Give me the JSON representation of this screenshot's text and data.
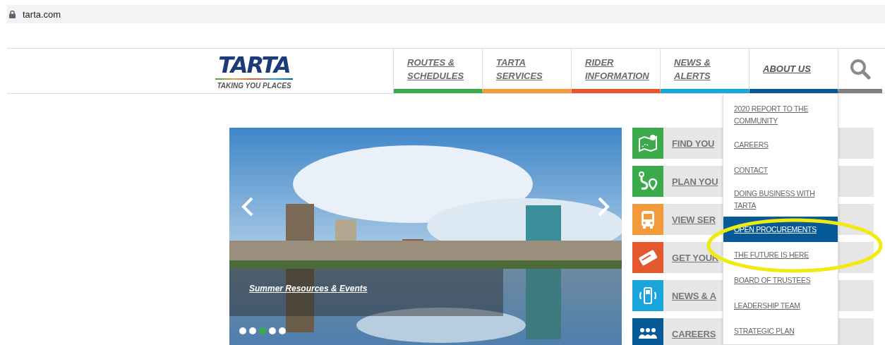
{
  "browser": {
    "url": "tarta.com"
  },
  "header": {
    "logo": {
      "name": "TARTA",
      "tagline": "TAKING YOU PLACES"
    },
    "nav": [
      {
        "label": "ROUTES & SCHEDULES",
        "color": "#3aaa4a",
        "expanded": false
      },
      {
        "label": "TARTA SERVICES",
        "color": "#f39a3b",
        "expanded": false
      },
      {
        "label": "RIDER INFORMATION",
        "color": "#e4582d",
        "expanded": false
      },
      {
        "label": "NEWS & ALERTS",
        "color": "#1aa6dc",
        "expanded": false
      },
      {
        "label": "ABOUT US",
        "color": "#075a98",
        "expanded": true
      }
    ]
  },
  "dropdown": [
    {
      "label": "2020 REPORT TO THE COMMUNITY",
      "selected": false
    },
    {
      "label": "CAREERS",
      "selected": false
    },
    {
      "label": "CONTACT",
      "selected": false
    },
    {
      "label": "DOING BUSINESS WITH TARTA",
      "selected": false
    },
    {
      "label": "OPEN PROCUREMENTS",
      "selected": true
    },
    {
      "label": "THE FUTURE IS HERE",
      "selected": false
    },
    {
      "label": "BOARD OF TRUSTEES",
      "selected": false
    },
    {
      "label": "LEADERSHIP TEAM",
      "selected": false
    },
    {
      "label": "STRATEGIC PLAN",
      "selected": false
    }
  ],
  "slideshow": {
    "caption": "Summer Resources & Events",
    "dots": [
      {
        "selected": false
      },
      {
        "selected": false
      },
      {
        "selected": true
      },
      {
        "selected": false
      },
      {
        "selected": false
      }
    ]
  },
  "quick_links": [
    {
      "label": "FIND YOU",
      "kind": "map",
      "color": "#3aaa4a"
    },
    {
      "label": "PLAN YOU",
      "kind": "route",
      "color": "#3aaa4a"
    },
    {
      "label": "VIEW SER",
      "kind": "bus",
      "color": "#f39a3b"
    },
    {
      "label": "GET YOUR",
      "kind": "ticket",
      "color": "#e4582d"
    },
    {
      "label": "NEWS & A",
      "kind": "phone",
      "color": "#1aa6dc"
    },
    {
      "label": "CAREERS",
      "kind": "people",
      "color": "#075a98"
    }
  ]
}
